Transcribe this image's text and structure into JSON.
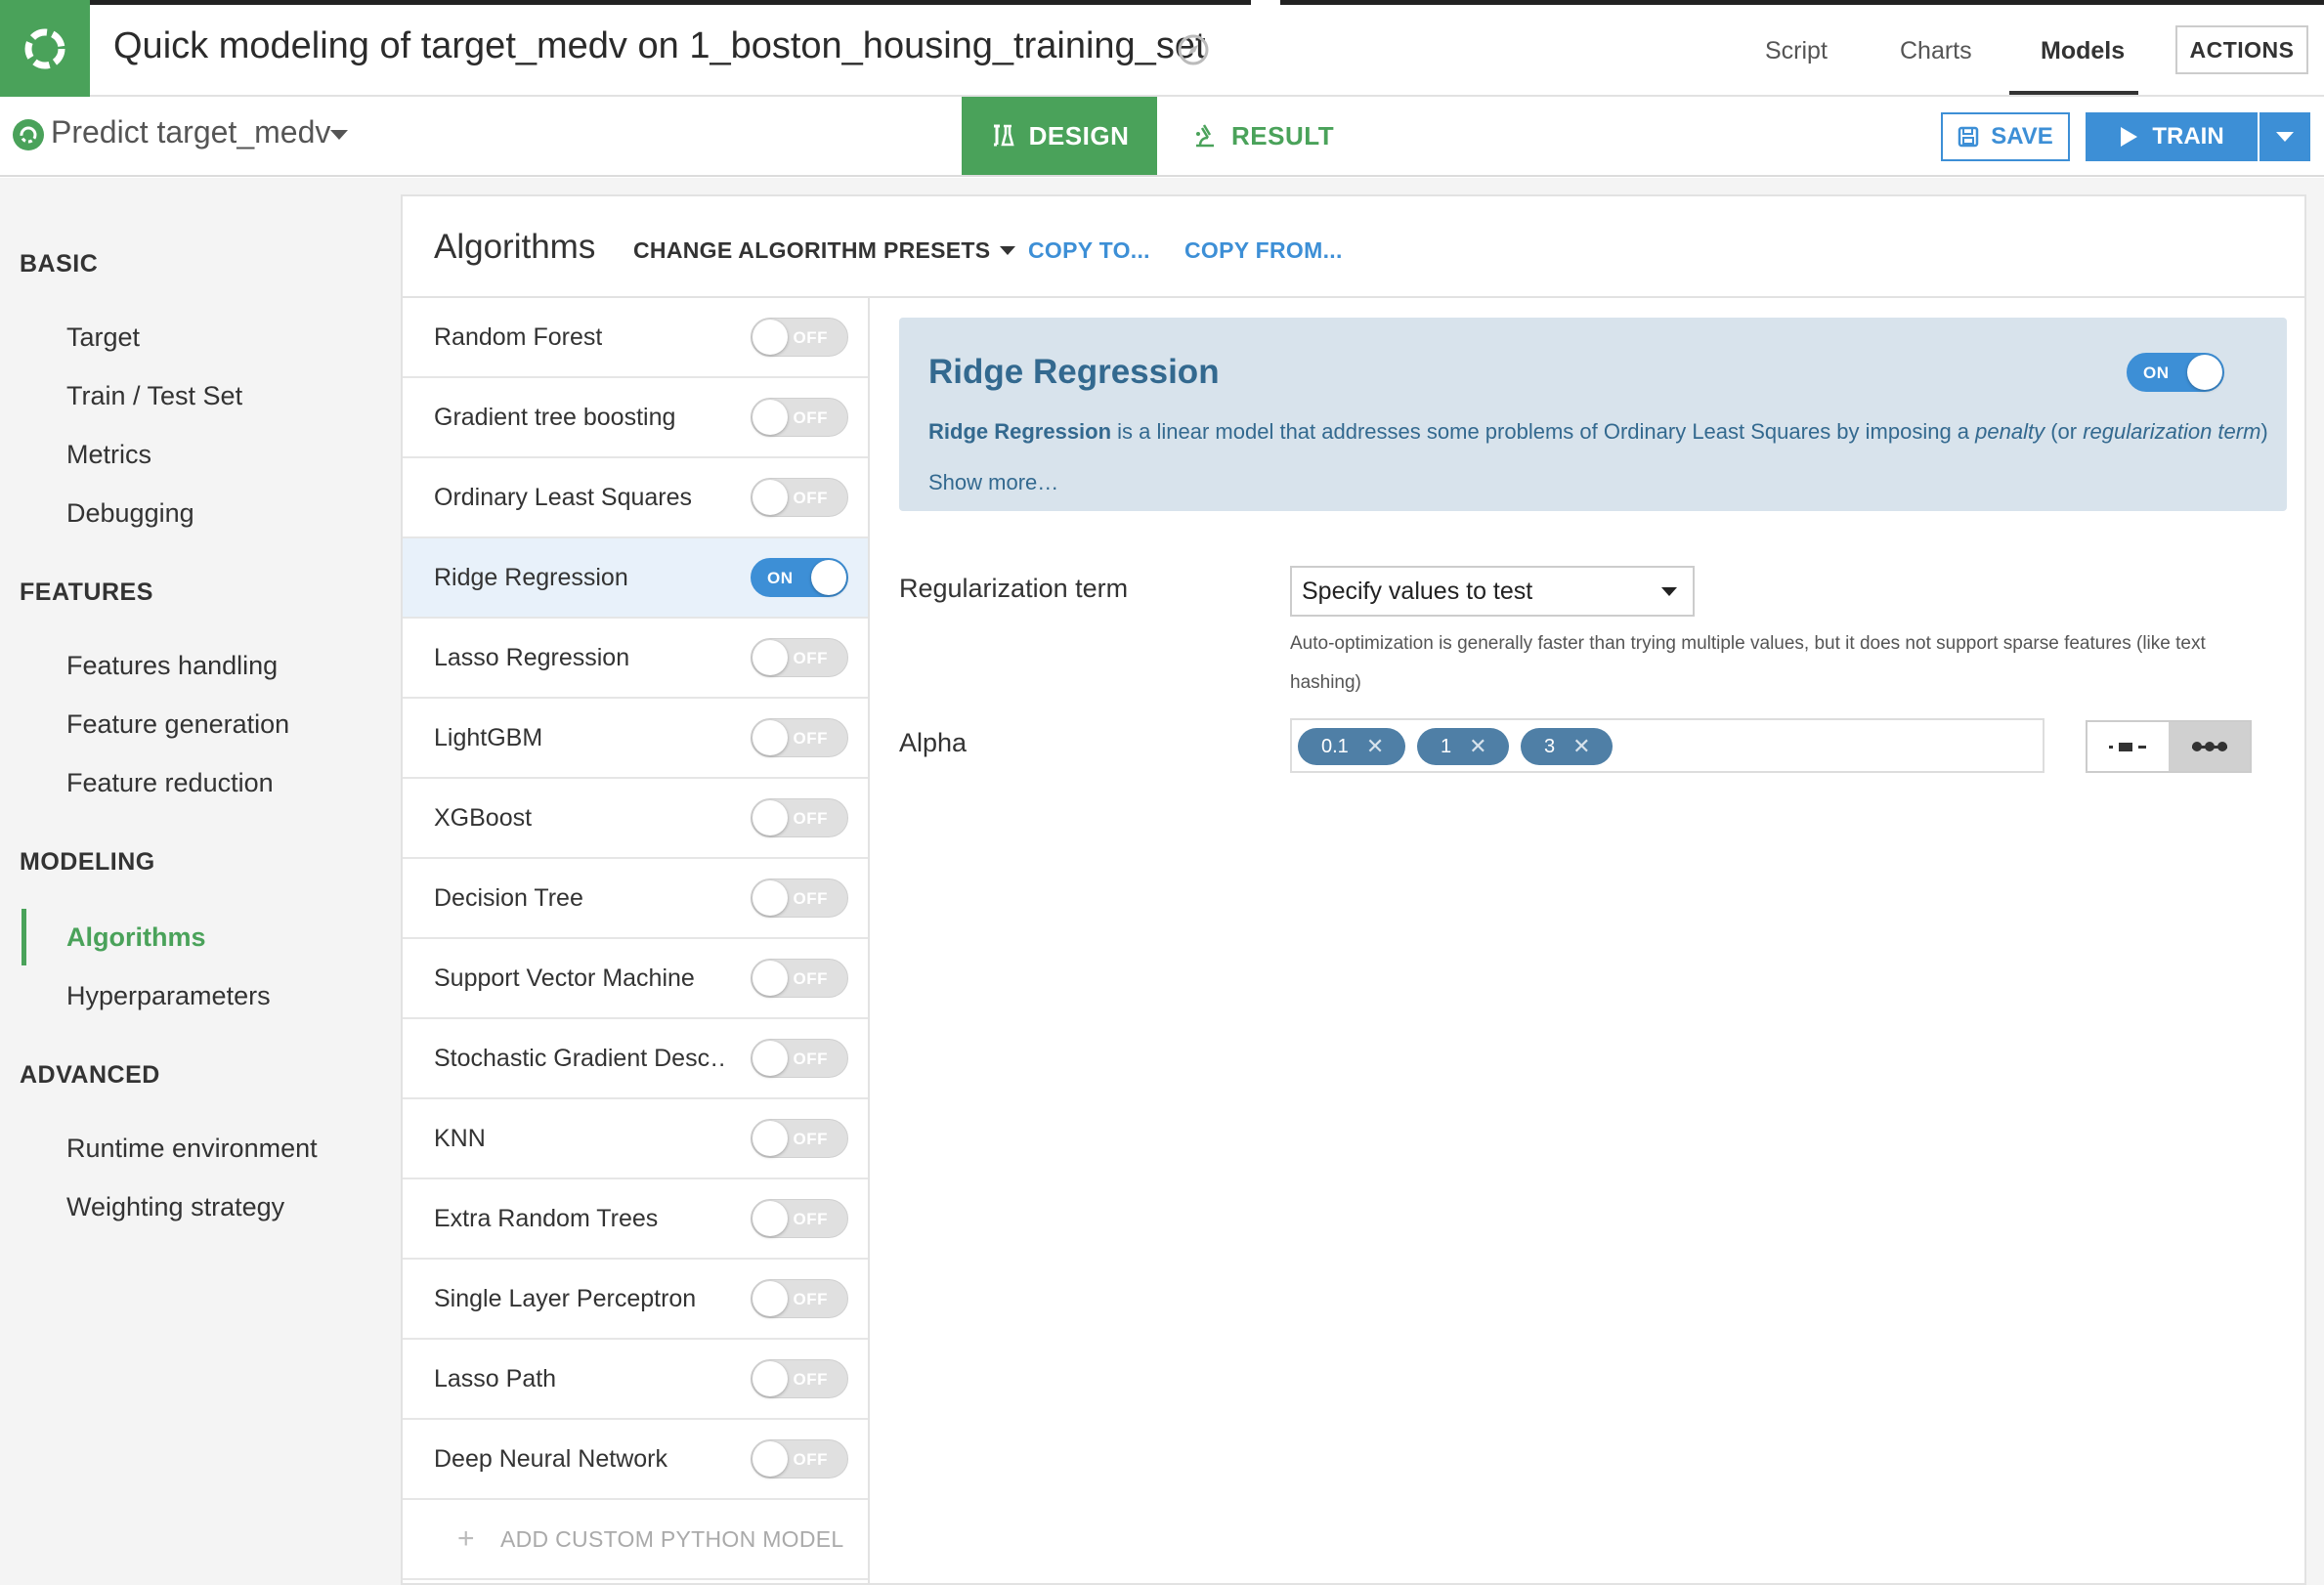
{
  "header": {
    "title": "Quick modeling of target_medv on 1_boston_housing_training_set",
    "nav": [
      "Script",
      "Charts",
      "Models"
    ],
    "active_nav": "Models",
    "actions_label": "ACTIONS"
  },
  "subbar": {
    "analysis_label": "Predict target_medv",
    "design_tab": "DESIGN",
    "result_tab": "RESULT",
    "save_label": "SAVE",
    "train_label": "TRAIN"
  },
  "sidebar": {
    "sections": [
      {
        "title": "BASIC",
        "items": [
          "Target",
          "Train / Test Set",
          "Metrics",
          "Debugging"
        ]
      },
      {
        "title": "FEATURES",
        "items": [
          "Features handling",
          "Feature generation",
          "Feature reduction"
        ]
      },
      {
        "title": "MODELING",
        "items": [
          "Algorithms",
          "Hyperparameters"
        ]
      },
      {
        "title": "ADVANCED",
        "items": [
          "Runtime environment",
          "Weighting strategy"
        ]
      }
    ],
    "active_item": "Algorithms"
  },
  "panel": {
    "title": "Algorithms",
    "presets_label": "CHANGE ALGORITHM PRESETS",
    "copy_to": "COPY TO...",
    "copy_from": "COPY FROM..."
  },
  "algorithms": [
    {
      "name": "Random Forest",
      "enabled": false,
      "state": "OFF"
    },
    {
      "name": "Gradient tree boosting",
      "enabled": false,
      "state": "OFF"
    },
    {
      "name": "Ordinary Least Squares",
      "enabled": false,
      "state": "OFF"
    },
    {
      "name": "Ridge Regression",
      "enabled": true,
      "state": "ON"
    },
    {
      "name": "Lasso Regression",
      "enabled": false,
      "state": "OFF"
    },
    {
      "name": "LightGBM",
      "enabled": false,
      "state": "OFF"
    },
    {
      "name": "XGBoost",
      "enabled": false,
      "state": "OFF"
    },
    {
      "name": "Decision Tree",
      "enabled": false,
      "state": "OFF"
    },
    {
      "name": "Support Vector Machine",
      "enabled": false,
      "state": "OFF"
    },
    {
      "name": "Stochastic Gradient Desc…",
      "enabled": false,
      "state": "OFF"
    },
    {
      "name": "KNN",
      "enabled": false,
      "state": "OFF"
    },
    {
      "name": "Extra Random Trees",
      "enabled": false,
      "state": "OFF"
    },
    {
      "name": "Single Layer Perceptron",
      "enabled": false,
      "state": "OFF"
    },
    {
      "name": "Lasso Path",
      "enabled": false,
      "state": "OFF"
    },
    {
      "name": "Deep Neural Network",
      "enabled": false,
      "state": "OFF"
    }
  ],
  "add_custom_label": "ADD CUSTOM PYTHON MODEL",
  "details": {
    "title": "Ridge Regression",
    "state": "ON",
    "desc_strong": "Ridge Regression",
    "desc_mid": " is a linear model that addresses some problems of Ordinary Least Squares by imposing a ",
    "desc_em1": "penalty",
    "desc_mid2": " (or ",
    "desc_em2": "regularization term",
    "desc_end": ")",
    "show_more": "Show more…",
    "regularization_label": "Regularization term",
    "regularization_value": "Specify values to test",
    "help_text": "Auto-optimization is generally faster than trying multiple values, but it does not support sparse features (like text hashing)",
    "alpha_label": "Alpha",
    "alpha_values": [
      "0.1",
      "1",
      "3"
    ]
  },
  "colors": {
    "brand_green": "#4aa25a",
    "primary_blue": "#3d8fd6",
    "info_bg": "#d8e3ec",
    "info_text": "#33698f",
    "tag_bg": "#4f7fa6"
  }
}
